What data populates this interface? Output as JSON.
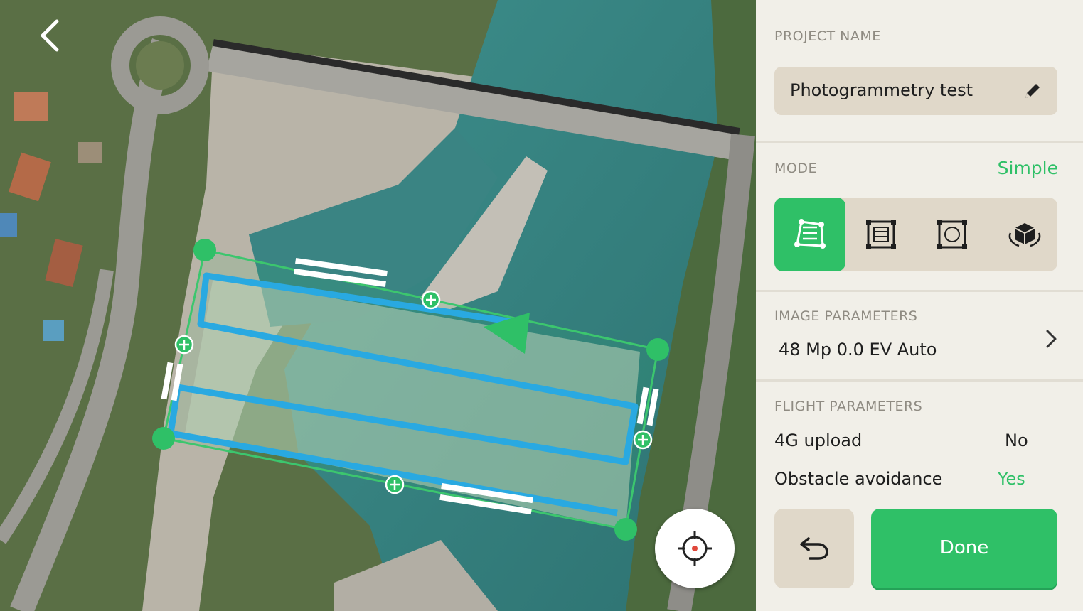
{
  "map": {
    "back_icon": "chevron-left-icon",
    "locate_icon": "crosshair-target-icon"
  },
  "panel": {
    "project_name_label": "PROJECT NAME",
    "project_name_value": "Photogrammetry test",
    "edit_icon": "pencil-icon",
    "mode_label": "MODE",
    "mode_value": "Simple",
    "modes": [
      {
        "icon": "polygon-area-icon",
        "active": true
      },
      {
        "icon": "grid-square-icon",
        "active": false
      },
      {
        "icon": "double-grid-icon",
        "active": false
      },
      {
        "icon": "orbit-3d-icon",
        "active": false
      }
    ],
    "image_params_label": "IMAGE PARAMETERS",
    "image_params_value": "48 Mp 0.0 EV Auto",
    "flight_params_label": "FLIGHT PARAMETERS",
    "upload_label": "4G upload",
    "upload_value": "No",
    "obstacle_label": "Obstacle avoidance",
    "obstacle_value": "Yes",
    "undo_icon": "undo-arrow-icon",
    "done_label": "Done"
  },
  "colors": {
    "accent_green": "#2fc067",
    "flight_path_blue": "#29a9e1",
    "panel_bg": "#f1efe8",
    "chip_bg": "#e0d8c9"
  }
}
